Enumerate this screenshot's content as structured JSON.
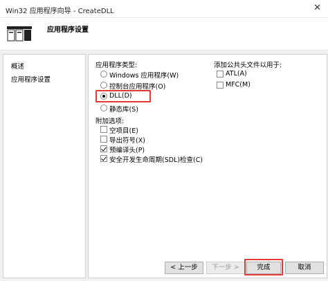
{
  "window": {
    "title": "Win32 应用程序向导 - CreateDLL",
    "close_glyph": "✕"
  },
  "header": {
    "title": "应用程序设置",
    "logo_icon": "window-stack-icon"
  },
  "nav": {
    "items": [
      {
        "label": "概述"
      },
      {
        "label": "应用程序设置"
      }
    ]
  },
  "app_type": {
    "label": "应用程序类型:",
    "options": [
      {
        "label": "Windows 应用程序(W)",
        "selected": false
      },
      {
        "label": "控制台应用程序(O)",
        "selected": false
      },
      {
        "label": "DLL(D)",
        "selected": true
      },
      {
        "label": "静态库(S)",
        "selected": false
      }
    ]
  },
  "extra": {
    "label": "附加选项:",
    "options": [
      {
        "label": "空项目(E)",
        "checked": false
      },
      {
        "label": "导出符号(X)",
        "checked": false
      },
      {
        "label": "预编译头(P)",
        "checked": true
      },
      {
        "label": "安全开发生命周期(SDL)检查(C)",
        "checked": true
      }
    ]
  },
  "headers": {
    "label": "添加公共头文件以用于:",
    "options": [
      {
        "label": "ATL(A)",
        "checked": false
      },
      {
        "label": "MFC(M)",
        "checked": false
      }
    ]
  },
  "buttons": {
    "prev": "< 上一步",
    "next": "下一步 >",
    "finish": "完成",
    "cancel": "取消"
  },
  "colors": {
    "highlight": "#e53935"
  }
}
